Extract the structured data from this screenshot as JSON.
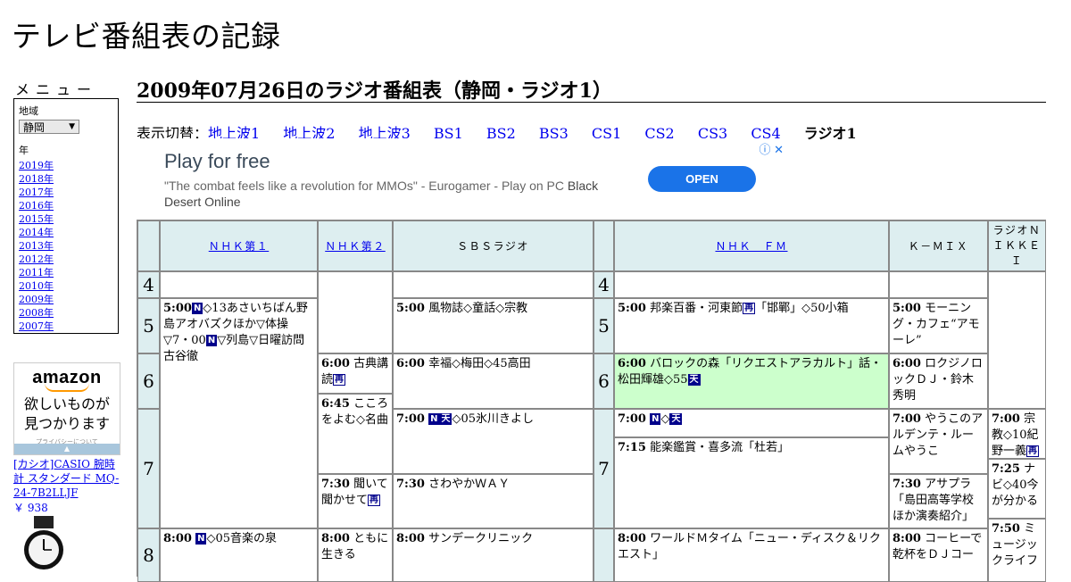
{
  "site": {
    "title": "テレビ番組表の記録"
  },
  "menu": {
    "heading": "メニュー",
    "region_label": "地域",
    "region_value": "静岡",
    "year_label": "年",
    "years": [
      "2019年",
      "2018年",
      "2017年",
      "2016年",
      "2015年",
      "2014年",
      "2013年",
      "2012年",
      "2011年",
      "2010年",
      "2009年",
      "2008年",
      "2007年"
    ]
  },
  "amazon_ad": {
    "logo": "amazon",
    "copy_line1": "欲しいものが",
    "copy_line2": "見つかります",
    "privacy": "プライバシーについて",
    "product": "[カシオ]CASIO 腕時計 スタンダード MQ-24-7B2LLJF",
    "price": "￥ 938"
  },
  "page": {
    "heading": "2009年07月26日のラジオ番組表（静岡・ラジオ1）",
    "switch_label": "表示切替：",
    "switch_links": [
      "地上波1",
      "地上波2",
      "地上波3",
      "BS1",
      "BS2",
      "BS3",
      "CS1",
      "CS2",
      "CS3",
      "CS4"
    ],
    "switch_current": "ラジオ1"
  },
  "banner_ad": {
    "title": "Play for free",
    "desc_quote": "\"The combat feels like a revolution for MMOs\" - Eurogamer - Play on PC",
    "desc_tail": "Black Desert Online",
    "cta": "OPEN",
    "icons": "ⓘ ✕"
  },
  "marks": {
    "news": "N",
    "weather": "天",
    "rebroadcast": "再"
  },
  "schedule": {
    "stations": [
      "ＮＨＫ第１",
      "ＮＨＫ第２",
      "ＳＢＳラジオ",
      "ＮＨＫ　ＦＭ",
      "Ｋ－ＭＩＸ",
      "ラジオＮＩＫＫＥＩ"
    ],
    "hours": [
      "4",
      "5",
      "6",
      "7",
      "8"
    ],
    "hours_right": [
      "4",
      "5",
      "6",
      "7"
    ],
    "programs": {
      "nhk1_500_time": "5:00",
      "nhk1_500_a": "◇13あさいちばん野島アオバズクほか▽体操▽7・00",
      "nhk1_500_b": "▽列島▽日曜訪問　古谷徹",
      "nhk1_800_time": "8:00",
      "nhk1_800_a": "◇05音楽の泉",
      "nhk2_600_time": "6:00",
      "nhk2_600_a": "古典講読",
      "nhk2_645_time": "6:45",
      "nhk2_645_a": "こころをよむ◇名曲",
      "nhk2_730_time": "7:30",
      "nhk2_730_a": "聞いて聞かせて",
      "nhk2_800_time": "8:00",
      "nhk2_800_a": "ともに生きる",
      "sbs_500_time": "5:00",
      "sbs_500_a": "風物誌◇童話◇宗教",
      "sbs_600_time": "6:00",
      "sbs_600_a": "幸福◇梅田◇45高田",
      "sbs_700_time": "7:00",
      "sbs_700_a": "◇05氷川きよし",
      "sbs_730_time": "7:30",
      "sbs_730_a": "さわやかＷＡＹ",
      "sbs_800_time": "8:00",
      "sbs_800_a": "サンデークリニック",
      "fm_500_time": "5:00",
      "fm_500_a": "邦楽百番・河東節",
      "fm_500_b": "「邯鄲」◇50小箱",
      "fm_600_time": "6:00",
      "fm_600_a": "バロックの森「リクエストアラカルト」話・松田輝雄◇55",
      "fm_700_time": "7:00",
      "fm_700_a": "◇",
      "fm_715_time": "7:15",
      "fm_715_a": "能楽鑑賞・喜多流「杜若」",
      "fm_800_time": "8:00",
      "fm_800_a": "ワールドＭタイム「ニュー・ディスク＆リクエスト」",
      "kmix_500_time": "5:00",
      "kmix_500_a": "モーニング・カフェ“アモーレ”",
      "kmix_600_time": "6:00",
      "kmix_600_a": "ロクジノロックＤＪ・鈴木秀明",
      "kmix_700_time": "7:00",
      "kmix_700_a": "やうこのアルデンテ・ルームやうこ",
      "kmix_730_time": "7:30",
      "kmix_730_a": "アサプラ「島田高等学校ほか演奏紹介」",
      "kmix_800_time": "8:00",
      "kmix_800_a": "コーヒーで乾杯をＤＪコー",
      "nikkei_700_time": "7:00",
      "nikkei_700_a": "宗教◇10紀野一義",
      "nikkei_725_time": "7:25",
      "nikkei_725_a": "ナビ◇40今が分かる",
      "nikkei_750_time": "7:50",
      "nikkei_750_a": "ミュージックライフ"
    }
  },
  "colors": {
    "header_bg": "#ddeef0",
    "highlight_bg": "#ccffcc",
    "link": "#0000ee",
    "ad_button": "#1a73e8"
  }
}
